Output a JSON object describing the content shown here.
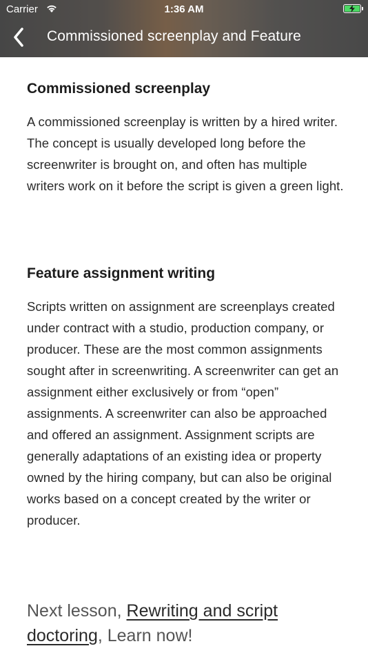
{
  "status_bar": {
    "carrier": "Carrier",
    "time": "1:36 AM"
  },
  "navbar": {
    "title": "Commissioned screenplay and Feature",
    "back_icon": "chevron-left-icon"
  },
  "sections": [
    {
      "title": "Commissioned screenplay",
      "body": "A commissioned screenplay is written by a hired writer. The concept is usually developed long before the screenwriter is brought on, and often has multiple writers work on it before the script is given a green light."
    },
    {
      "title": "Feature assignment writing",
      "body": "Scripts written on assignment are screenplays created under contract with a studio, production company, or producer. These are the most common assignments sought after in screenwriting. A screenwriter can get an assignment either exclusively or from “open” assignments. A screenwriter can also be approached and offered an assignment. Assignment scripts are generally adaptations of an existing idea or property owned by the hiring company, but can also be original works based on a concept created by the writer or producer."
    }
  ],
  "footer": {
    "prefix": "Next lesson, ",
    "link": "Rewriting and script doctoring",
    "suffix": ", Learn now!"
  },
  "colors": {
    "battery": "#4cd964",
    "header_accent": "#8a6a4c"
  }
}
